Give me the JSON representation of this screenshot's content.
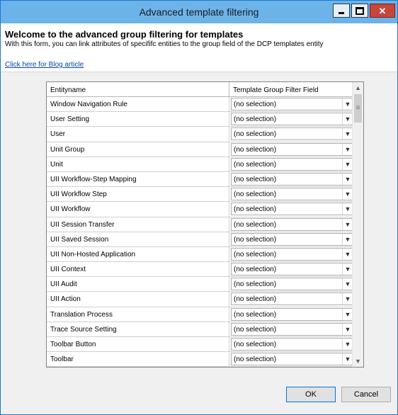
{
  "window": {
    "title": "Advanced template filtering"
  },
  "header": {
    "title": "Welcome to the advanced group filtering for templates",
    "description": "With this form, you can link attributes of specififc entities to the group field of the DCP templates entity",
    "link": "Click here for Blog article"
  },
  "grid": {
    "columns": [
      "Entityname",
      "Template Group Filter Field"
    ],
    "rows": [
      {
        "name": "Window Navigation Rule",
        "field": "(no selection)"
      },
      {
        "name": "User Setting",
        "field": "(no selection)"
      },
      {
        "name": "User",
        "field": "(no selection)"
      },
      {
        "name": "Unit Group",
        "field": "(no selection)"
      },
      {
        "name": "Unit",
        "field": "(no selection)"
      },
      {
        "name": "UII Workflow-Step Mapping",
        "field": "(no selection)"
      },
      {
        "name": "UII Workflow Step",
        "field": "(no selection)"
      },
      {
        "name": "UII Workflow",
        "field": "(no selection)"
      },
      {
        "name": "UII Session Transfer",
        "field": "(no selection)"
      },
      {
        "name": "UII Saved Session",
        "field": "(no selection)"
      },
      {
        "name": "UII Non-Hosted Application",
        "field": "(no selection)"
      },
      {
        "name": "UII Context",
        "field": "(no selection)"
      },
      {
        "name": "UII Audit",
        "field": "(no selection)"
      },
      {
        "name": "UII Action",
        "field": "(no selection)"
      },
      {
        "name": "Translation Process",
        "field": "(no selection)"
      },
      {
        "name": "Trace Source Setting",
        "field": "(no selection)"
      },
      {
        "name": "Toolbar Button",
        "field": "(no selection)"
      },
      {
        "name": "Toolbar",
        "field": "(no selection)"
      }
    ]
  },
  "buttons": {
    "ok": "OK",
    "cancel": "Cancel"
  },
  "icons": {
    "minimize": "minimize-icon",
    "maximize": "maximize-icon",
    "close": "close-icon",
    "dropdown": "chevron-down-icon"
  },
  "colors": {
    "titlebar": "#6cb3ea",
    "close_button": "#c7463c",
    "link": "#0645ad",
    "window_border": "#1979ca"
  }
}
